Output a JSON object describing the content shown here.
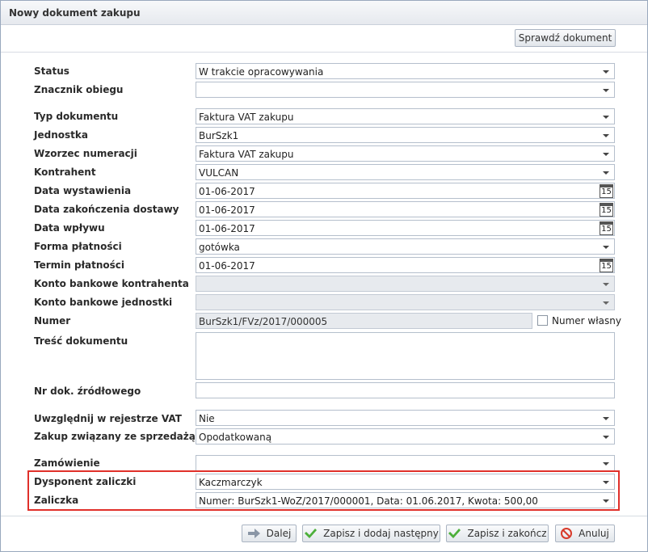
{
  "window": {
    "title": "Nowy dokument zakupu"
  },
  "toolbar": {
    "check_label": "Sprawdź dokument"
  },
  "fields": {
    "status": {
      "label": "Status",
      "value": "W trakcie opracowywania"
    },
    "znacznik": {
      "label": "Znacznik obiegu",
      "value": ""
    },
    "typ": {
      "label": "Typ dokumentu",
      "value": "Faktura VAT zakupu"
    },
    "jednostka": {
      "label": "Jednostka",
      "value": "BurSzk1"
    },
    "wzorzec": {
      "label": "Wzorzec numeracji",
      "value": "Faktura VAT zakupu"
    },
    "kontrahent": {
      "label": "Kontrahent",
      "value": "VULCAN"
    },
    "data_wyst": {
      "label": "Data wystawienia",
      "value": "01-06-2017"
    },
    "data_zak": {
      "label": "Data zakończenia dostawy",
      "value": "01-06-2017"
    },
    "data_wpl": {
      "label": "Data wpływu",
      "value": "01-06-2017"
    },
    "forma": {
      "label": "Forma płatności",
      "value": "gotówka"
    },
    "termin": {
      "label": "Termin płatności",
      "value": "01-06-2017"
    },
    "konto_kontr": {
      "label": "Konto bankowe kontrahenta",
      "value": ""
    },
    "konto_jedn": {
      "label": "Konto bankowe jednostki",
      "value": ""
    },
    "numer": {
      "label": "Numer",
      "value": "BurSzk1/FVz/2017/000005",
      "own_label": "Numer własny"
    },
    "tresc": {
      "label": "Treść dokumentu",
      "value": ""
    },
    "nr_zrodl": {
      "label": "Nr dok. źródłowego",
      "value": ""
    },
    "vat": {
      "label": "Uwzględnij w rejestrze VAT",
      "value": "Nie"
    },
    "zakup": {
      "label": "Zakup związany ze sprzedażą",
      "value": "Opodatkowaną"
    },
    "zamowienie": {
      "label": "Zamówienie",
      "value": ""
    },
    "dysponent": {
      "label": "Dysponent zaliczki",
      "value": "Kaczmarczyk"
    },
    "zaliczka": {
      "label": "Zaliczka",
      "value": "Numer: BurSzk1-WoZ/2017/000001, Data: 01.06.2017, Kwota: 500,00"
    }
  },
  "calendar_icon_text": "15",
  "footer": {
    "next_label": "Dalej",
    "save_add_label": "Zapisz i dodaj następny",
    "save_close_label": "Zapisz i zakończ",
    "cancel_label": "Anuluj"
  },
  "colors": {
    "highlight_frame": "#e0302a",
    "check_icon": "#4caf3a",
    "cancel_icon": "#d83a2a"
  }
}
